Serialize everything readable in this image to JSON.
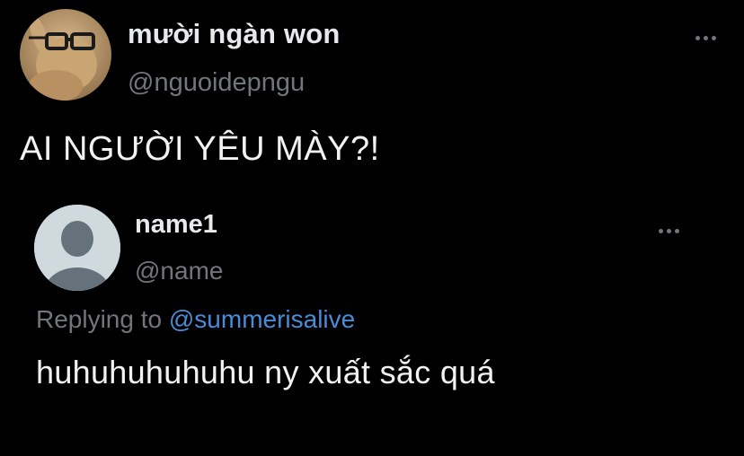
{
  "main_tweet": {
    "display_name": "mười ngàn won",
    "handle": "@nguoidepngu",
    "text": "AI NGƯỜI YÊU MÀY?!",
    "avatar_icon": "bunny-with-glasses-avatar",
    "more_icon": "more-options-icon"
  },
  "reply": {
    "display_name": "name1",
    "handle": "@name",
    "replying_prefix": "Replying to ",
    "replying_mention": "@summerisalive",
    "text": "huhuhuhuhuhu ny xuất sắc quá",
    "avatar_icon": "default-profile-avatar",
    "more_icon": "more-options-icon"
  },
  "colors": {
    "background": "#000000",
    "primary_text": "#e7e9ea",
    "secondary_text": "#71767b",
    "link": "#4a8bd8"
  }
}
